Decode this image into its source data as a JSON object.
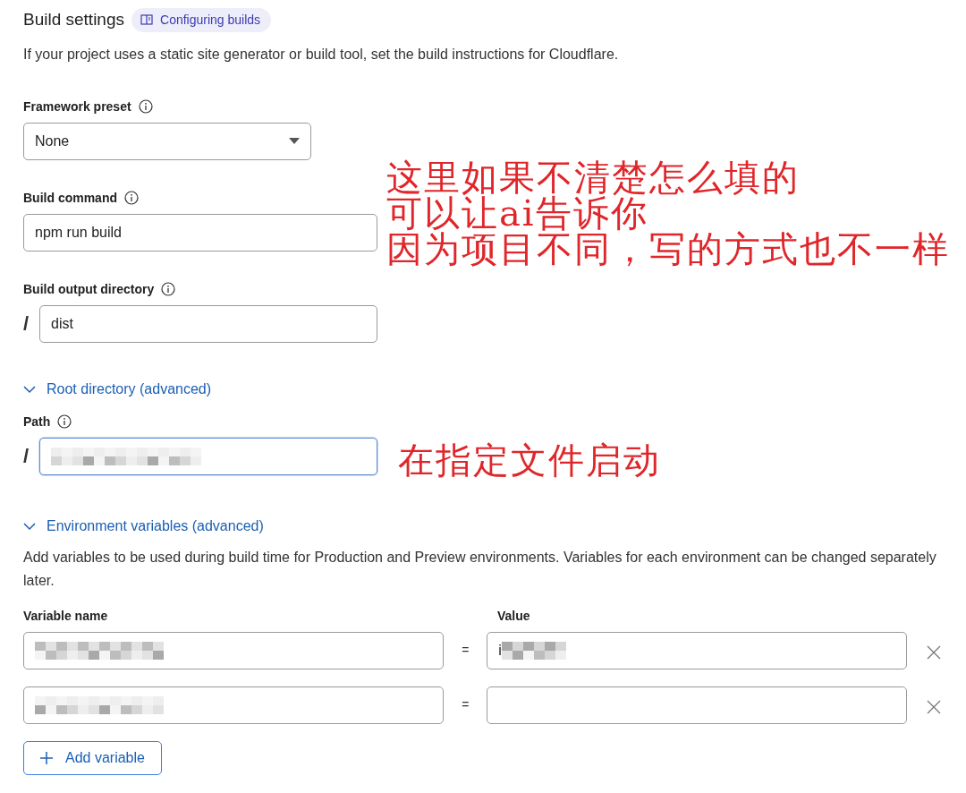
{
  "header": {
    "title": "Build settings",
    "doc_link": "Configuring builds"
  },
  "description": "If your project uses a static site generator or build tool, set the build instructions for Cloudflare.",
  "fields": [
    {
      "kind": "select",
      "label": "Framework preset",
      "info": true,
      "value": "None"
    },
    {
      "kind": "text",
      "label": "Build command",
      "info": true,
      "value": "npm run build"
    },
    {
      "kind": "path",
      "label": "Build output directory",
      "info": true,
      "prefix": "/",
      "value": "dist"
    }
  ],
  "root_directory": {
    "toggle": "Root directory (advanced)",
    "expanded": true,
    "label": "Path",
    "info": true,
    "prefix": "/",
    "focused": true,
    "redacted": true
  },
  "environment": {
    "toggle": "Environment variables (advanced)",
    "expanded": true,
    "description": "Add variables to be used during build time for Production and Preview environments. Variables for each environment can be changed separately later.",
    "name_header": "Variable name",
    "value_header": "Value",
    "variables": [
      {
        "name_redacted": true,
        "separator": "=",
        "value": "i",
        "value_redacted": true
      },
      {
        "name_redacted": true,
        "separator": "=",
        "value_redacted": false
      }
    ],
    "add_button": "Add variable"
  },
  "annotations": [
    {
      "lines": [
        "这里如果不清楚怎么填的",
        "可以让ai告诉你",
        "因为项目不同，写的方式也不一样"
      ]
    },
    {
      "lines": [
        "在指定文件启动"
      ]
    }
  ]
}
